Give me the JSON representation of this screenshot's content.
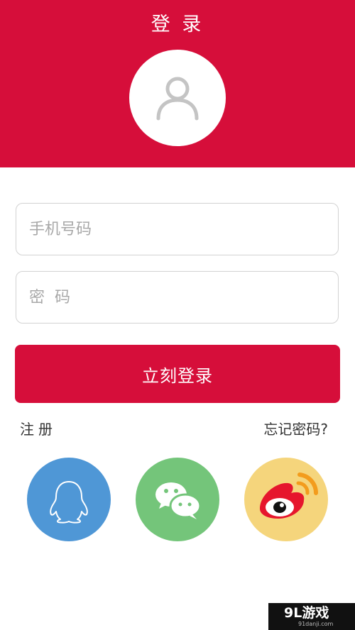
{
  "header": {
    "title": "登 录",
    "avatar_icon": "user-icon",
    "background": "#d60e3a"
  },
  "form": {
    "phone_placeholder": "手机号码",
    "password_placeholder": "密  码",
    "login_label": "立刻登录"
  },
  "links": {
    "register": "注册",
    "forgot_password": "忘记密码?"
  },
  "social": [
    {
      "name": "qq",
      "icon": "qq-penguin-icon",
      "color": "#4f97d6"
    },
    {
      "name": "wechat",
      "icon": "wechat-icon",
      "color": "#74c57a"
    },
    {
      "name": "weibo",
      "icon": "weibo-icon",
      "color": "#f5d57c"
    }
  ],
  "watermark": {
    "logo": "9L游戏",
    "domain": "91danji.com"
  },
  "colors": {
    "accent": "#d60e3a",
    "field_border": "#d2d2d2",
    "placeholder": "#a8a8a8"
  }
}
